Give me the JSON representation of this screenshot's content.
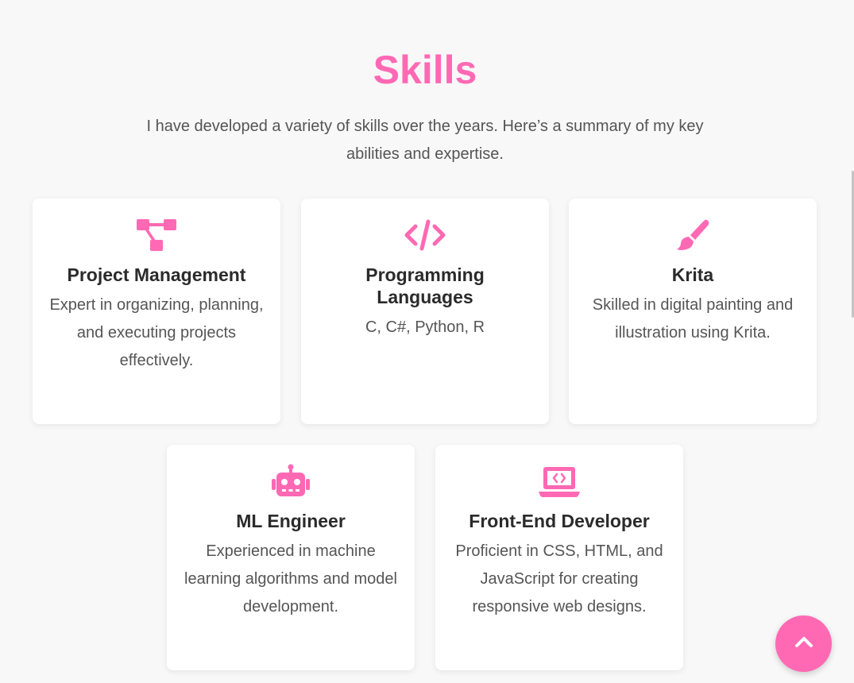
{
  "skills_section": {
    "title": "Skills",
    "intro": "I have developed a variety of skills over the years. Here’s a summary of my key abilities and expertise."
  },
  "skills": [
    {
      "icon": "project-diagram-icon",
      "title": "Project Management",
      "description": "Expert in organizing, planning, and executing projects effectively."
    },
    {
      "icon": "code-icon",
      "title": "Programming Languages",
      "description": "C, C#, Python, R"
    },
    {
      "icon": "paintbrush-icon",
      "title": "Krita",
      "description": "Skilled in digital painting and illustration using Krita."
    },
    {
      "icon": "robot-icon",
      "title": "ML Engineer",
      "description": "Experienced in machine learning algorithms and model development."
    },
    {
      "icon": "laptop-code-icon",
      "title": "Front-End Developer",
      "description": "Proficient in CSS, HTML, and JavaScript for creating responsive web designs."
    }
  ],
  "back_to_top": {
    "icon": "chevron-up-icon"
  },
  "colors": {
    "accent": "#ff69b4",
    "text": "#555555",
    "heading": "#2b2b2b",
    "background": "#f8f8f8"
  }
}
